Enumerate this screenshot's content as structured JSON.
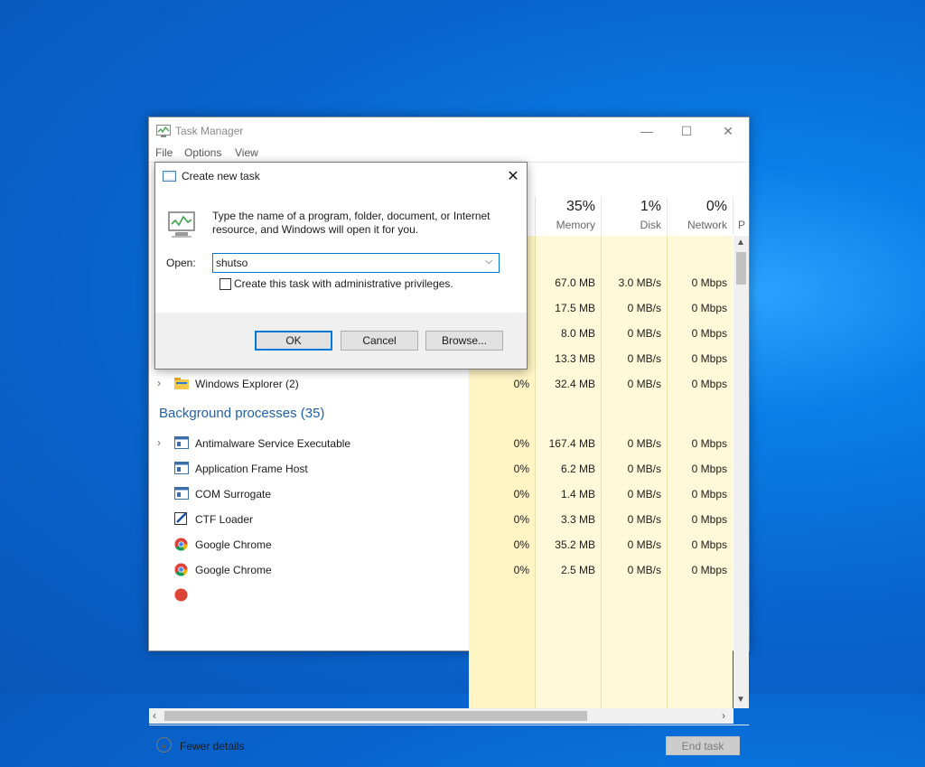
{
  "task_manager": {
    "title": "Task Manager",
    "menu": [
      "File",
      "Options",
      "View"
    ],
    "window_controls": {
      "minimize": "—",
      "maximize": "☐",
      "close": "✕"
    },
    "columns": [
      {
        "pct": "35%",
        "name": "Memory"
      },
      {
        "pct": "1%",
        "name": "Disk"
      },
      {
        "pct": "0%",
        "name": "Network"
      },
      {
        "pct": "",
        "name": "P"
      }
    ],
    "app_rows_visible": [
      {
        "memory": "67.0 MB",
        "disk": "3.0 MB/s",
        "network": "0 Mbps"
      },
      {
        "memory": "17.5 MB",
        "disk": "0 MB/s",
        "network": "0 Mbps"
      },
      {
        "memory": "8.0 MB",
        "disk": "0 MB/s",
        "network": "0 Mbps"
      },
      {
        "memory": "13.3 MB",
        "disk": "0 MB/s",
        "network": "0 Mbps"
      },
      {
        "name": "Windows Explorer (2)",
        "cpu": "0%",
        "memory": "32.4 MB",
        "disk": "0 MB/s",
        "network": "0 Mbps",
        "icon": "folder-icon",
        "expandable": true
      }
    ],
    "background_section": "Background processes (35)",
    "background_rows": [
      {
        "name": "Antimalware Service Executable",
        "cpu": "0%",
        "memory": "167.4 MB",
        "disk": "0 MB/s",
        "network": "0 Mbps",
        "icon": "service-icon",
        "expandable": true
      },
      {
        "name": "Application Frame Host",
        "cpu": "0%",
        "memory": "6.2 MB",
        "disk": "0 MB/s",
        "network": "0 Mbps",
        "icon": "service-icon",
        "expandable": false
      },
      {
        "name": "COM Surrogate",
        "cpu": "0%",
        "memory": "1.4 MB",
        "disk": "0 MB/s",
        "network": "0 Mbps",
        "icon": "service-icon",
        "expandable": false
      },
      {
        "name": "CTF Loader",
        "cpu": "0%",
        "memory": "3.3 MB",
        "disk": "0 MB/s",
        "network": "0 Mbps",
        "icon": "pen-icon",
        "expandable": false
      },
      {
        "name": "Google Chrome",
        "cpu": "0%",
        "memory": "35.2 MB",
        "disk": "0 MB/s",
        "network": "0 Mbps",
        "icon": "chrome-icon",
        "expandable": false
      },
      {
        "name": "Google Chrome",
        "cpu": "0%",
        "memory": "2.5 MB",
        "disk": "0 MB/s",
        "network": "0 Mbps",
        "icon": "chrome-icon",
        "expandable": false
      }
    ],
    "footer": {
      "fewer_details": "Fewer details",
      "end_task": "End task"
    }
  },
  "dialog": {
    "title": "Create new task",
    "description": "Type the name of a program, folder, document, or Internet resource, and Windows will open it for you.",
    "open_label": "Open:",
    "open_value": "shutso",
    "admin_checkbox_label": "Create this task with administrative privileges.",
    "admin_checked": false,
    "buttons": {
      "ok": "OK",
      "cancel": "Cancel",
      "browse": "Browse..."
    }
  },
  "colors": {
    "heat_light": "#fff9d9",
    "heat_mid": "#fff4c4",
    "accent": "#0078d7",
    "section": "#1f5fa8"
  }
}
